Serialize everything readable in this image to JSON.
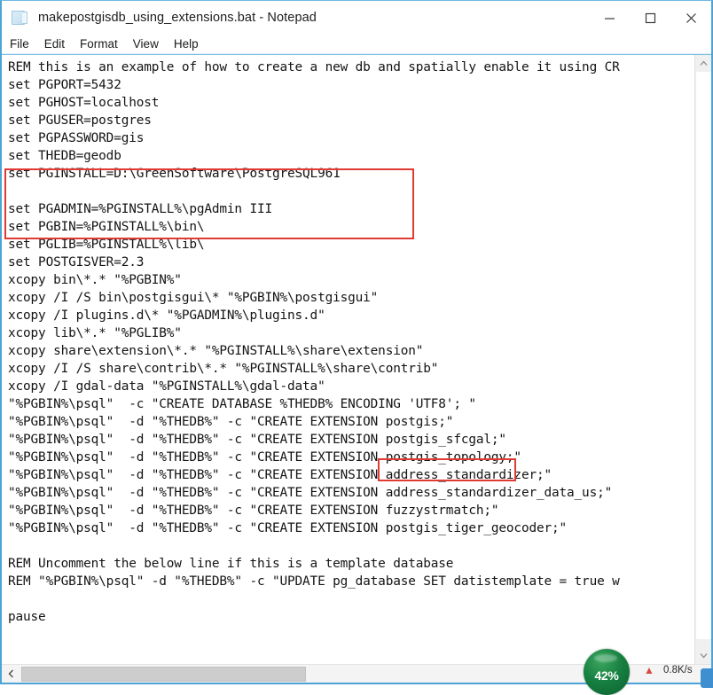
{
  "window": {
    "title": "makepostgisdb_using_extensions.bat - Notepad",
    "icon": "notepad-document-icon",
    "controls": {
      "minimize": "minimize-icon",
      "maximize": "maximize-icon",
      "close": "close-icon"
    }
  },
  "menu": {
    "items": [
      {
        "label": "File"
      },
      {
        "label": "Edit"
      },
      {
        "label": "Format"
      },
      {
        "label": "View"
      },
      {
        "label": "Help"
      }
    ]
  },
  "editor": {
    "lines": [
      "REM this is an example of how to create a new db and spatially enable it using CR",
      "set PGPORT=5432",
      "set PGHOST=localhost",
      "set PGUSER=postgres",
      "set PGPASSWORD=gis",
      "set THEDB=geodb",
      "set PGINSTALL=D:\\GreenSoftware\\PostgreSQL961",
      "",
      "set PGADMIN=%PGINSTALL%\\pgAdmin III",
      "set PGBIN=%PGINSTALL%\\bin\\",
      "set PGLIB=%PGINSTALL%\\lib\\",
      "set POSTGISVER=2.3",
      "xcopy bin\\*.* \"%PGBIN%\"",
      "xcopy /I /S bin\\postgisgui\\* \"%PGBIN%\\postgisgui\"",
      "xcopy /I plugins.d\\* \"%PGADMIN%\\plugins.d\"",
      "xcopy lib\\*.* \"%PGLIB%\"",
      "xcopy share\\extension\\*.* \"%PGINSTALL%\\share\\extension\"",
      "xcopy /I /S share\\contrib\\*.* \"%PGINSTALL%\\share\\contrib\"",
      "xcopy /I gdal-data \"%PGINSTALL%\\gdal-data\"",
      "\"%PGBIN%\\psql\"  -c \"CREATE DATABASE %THEDB% ENCODING 'UTF8'; \"",
      "\"%PGBIN%\\psql\"  -d \"%THEDB%\" -c \"CREATE EXTENSION postgis;\"",
      "\"%PGBIN%\\psql\"  -d \"%THEDB%\" -c \"CREATE EXTENSION postgis_sfcgal;\"",
      "\"%PGBIN%\\psql\"  -d \"%THEDB%\" -c \"CREATE EXTENSION postgis_topology;\"",
      "\"%PGBIN%\\psql\"  -d \"%THEDB%\" -c \"CREATE EXTENSION address_standardizer;\"",
      "\"%PGBIN%\\psql\"  -d \"%THEDB%\" -c \"CREATE EXTENSION address_standardizer_data_us;\"",
      "\"%PGBIN%\\psql\"  -d \"%THEDB%\" -c \"CREATE EXTENSION fuzzystrmatch;\"",
      "\"%PGBIN%\\psql\"  -d \"%THEDB%\" -c \"CREATE EXTENSION postgis_tiger_geocoder;\"",
      "",
      "REM Uncomment the below line if this is a template database",
      "REM \"%PGBIN%\\psql\" -d \"%THEDB%\" -c \"UPDATE pg_database SET datistemplate = true w",
      "",
      "pause"
    ]
  },
  "annotations": {
    "highlight_color": "#e03a35",
    "boxes": [
      {
        "name": "connection-variables-highlight"
      },
      {
        "name": "encoding-clause-highlight"
      }
    ]
  },
  "scrollbars": {
    "vertical": {
      "up_arrow": "chevron-up-icon",
      "down_arrow": "chevron-down-icon"
    },
    "horizontal": {
      "left_arrow": "chevron-left-icon"
    }
  },
  "overlay": {
    "progress_percent": "42%",
    "upload_arrow": "upload-arrow-icon",
    "speed": "0.8K/s",
    "accent_color": "#167f40"
  }
}
